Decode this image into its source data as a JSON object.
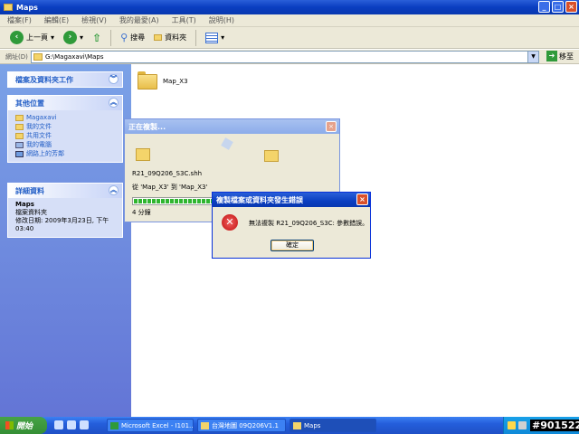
{
  "window": {
    "title": "Maps",
    "min": "_",
    "max": "□",
    "close": "×"
  },
  "menu": [
    "檔案(F)",
    "編輯(E)",
    "檢視(V)",
    "我的最愛(A)",
    "工具(T)",
    "說明(H)"
  ],
  "toolbar": {
    "back": "上一頁",
    "search": "搜尋",
    "folders": "資料夾"
  },
  "address": {
    "label": "網址(D)",
    "path": "G:\\Magaxavi\\Maps",
    "go": "移至"
  },
  "sidebar": {
    "tasks_title": "檔案及資料夾工作",
    "other_title": "其他位置",
    "other_items": [
      "Magaxavi",
      "我的文件",
      "共用文件",
      "我的電腦",
      "網路上的芳鄰"
    ],
    "details_title": "詳細資料",
    "details_name": "Maps",
    "details_type": "檔案資料夾",
    "details_mod": "修改日期: 2009年3月23日, 下午 03:40"
  },
  "content": {
    "folder_name": "Map_X3"
  },
  "copy_dialog": {
    "title": "正在複製...",
    "filename": "R21_09Q206_S3C.shh",
    "from_to": "從 'Map_X3' 到 'Map_X3'",
    "time_left": "4 分鐘",
    "progress": 0.98
  },
  "error_dialog": {
    "title": "複製檔案或資料夾發生錯誤",
    "message": "無法複製 R21_09Q206_S3C: 參數錯誤。",
    "ok": "確定"
  },
  "taskbar": {
    "start": "開始",
    "tasks": [
      {
        "label": "Microsoft Excel - I101..."
      },
      {
        "label": "台灣地圖 09Q206V1.1"
      },
      {
        "label": "Maps"
      }
    ],
    "watermark": "#901522"
  }
}
